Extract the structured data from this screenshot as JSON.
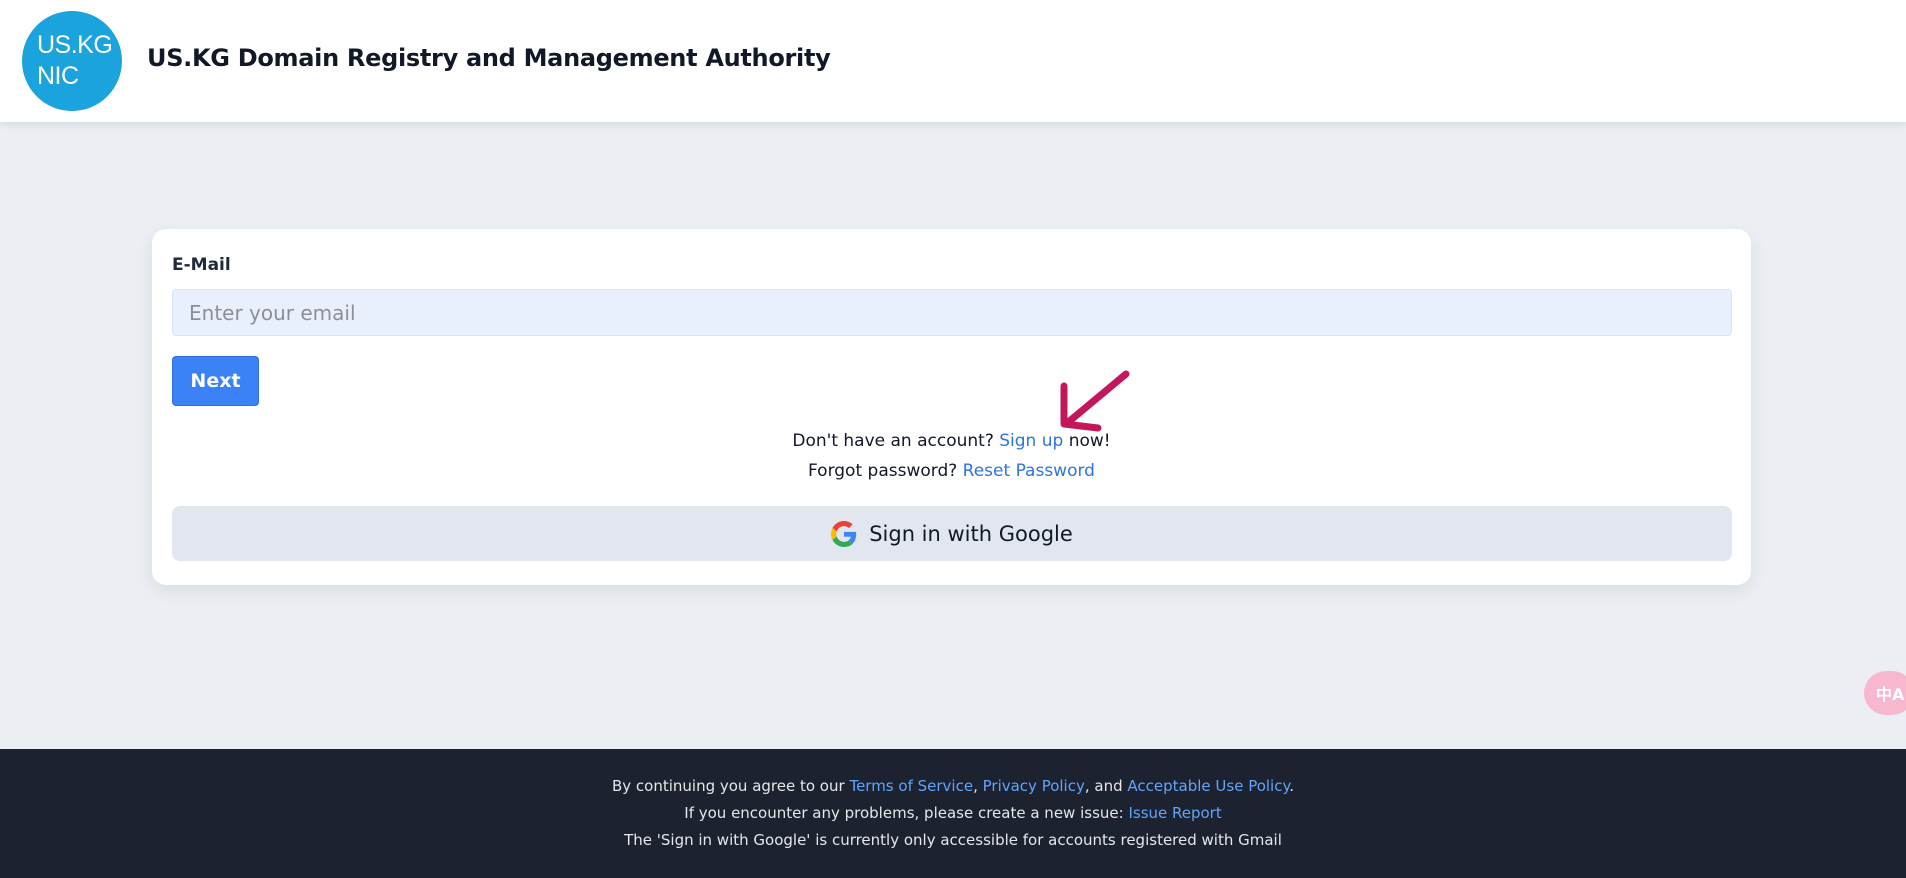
{
  "header": {
    "logo_line1": "US.KG",
    "logo_line2": "NIC",
    "title": "US.KG Domain Registry and Management Authority"
  },
  "login": {
    "email_label": "E-Mail",
    "email_placeholder": "Enter your email",
    "email_value": "",
    "next_label": "Next",
    "signup_prefix": "Don't have an account?",
    "signup_link": "Sign up",
    "signup_suffix": "now!",
    "forgot_prefix": "Forgot password?",
    "reset_link": "Reset Password",
    "google_label": "Sign in with Google"
  },
  "footer": {
    "agree_prefix": "By continuing you agree to our",
    "terms_link": "Terms of Service",
    "privacy_link": "Privacy Policy",
    "and_text": ", and",
    "aup_link": "Acceptable Use Policy",
    "problems_text": "If you encounter any problems, please create a new issue:",
    "issue_link": "Issue Report",
    "google_note": "The 'Sign in with Google' is currently only accessible for accounts registered with Gmail"
  },
  "widgets": {
    "translate_glyph": "中A",
    "annotation_arrow": "arrow-icon"
  },
  "colors": {
    "accent": "#3b82f6",
    "link": "#2d74e3",
    "logo": "#1aa3dc",
    "arrow": "#c2185b",
    "footer_bg": "#1c2230"
  }
}
